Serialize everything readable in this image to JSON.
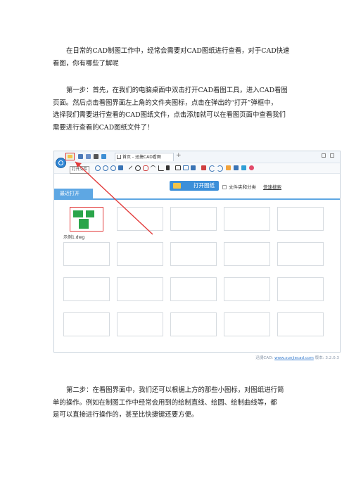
{
  "paragraph1": {
    "lines": [
      "在日常的CAD制图工作中，经常会需要对CAD图纸进行查看，对于CAD快速",
      "看图，你有哪些了解呢"
    ]
  },
  "paragraph2": {
    "lines": [
      "第一步：首先，在我们的电脑桌面中双击打开CAD看图工具，进入CAD看图",
      "页面。然后点击看图界面左上角的文件夹图标，点击在弹出的“打开”弹框中，",
      "选择我们需要进行查看的CAD图纸文件，点击添加就可以在看图页面中查看我们",
      "需要进行查看的CAD图纸文件了！"
    ]
  },
  "paragraph3": {
    "lines": [
      "第二步：在看图界面中，我们还可以根据上方的那些小图标，对图纸进行简",
      "单的操作。例如在制图工作中经常会用到的绘制直线、绘圆、绘制曲线等，都",
      "是可以直接进行操作的，甚至比快捷键还要方便。"
    ]
  },
  "screenshot": {
    "tooltip": "打开文件",
    "tab_title": "首页 - 迅捷CAD看图",
    "tab_plus": "+",
    "recent_label": "最近打开",
    "open_drawing_button": "打开图纸",
    "checkbox_label": "文件夹和分类",
    "quick_search_link": "快速搜索",
    "recent_file_name": "示例1.dwg",
    "footer_prefix": "迅捷CAD: ",
    "footer_link": "www.xunjiecad.com",
    "footer_version": " 版本: 3.2.0.3",
    "accent_color": "#5ea7e3",
    "highlight_color": "#e23b3b"
  }
}
